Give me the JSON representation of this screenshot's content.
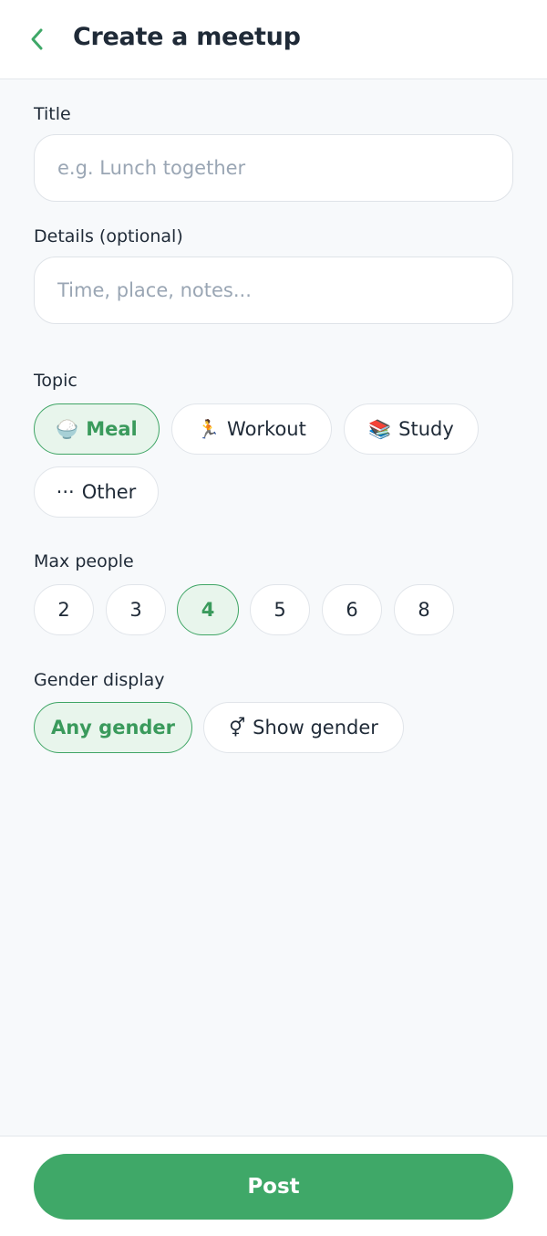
{
  "header": {
    "title": "Create a meetup",
    "back_icon": "chevron-left-icon"
  },
  "form": {
    "title_label": "Title",
    "title_placeholder": "e.g. Lunch together",
    "details_label": "Details (optional)",
    "details_placeholder": "Time, place, notes...",
    "topic_label": "Topic",
    "topics": [
      {
        "icon": "🍚",
        "label": "Meal",
        "selected": true
      },
      {
        "icon": "🏃",
        "label": "Workout",
        "selected": false
      },
      {
        "icon": "📚",
        "label": "Study",
        "selected": false
      },
      {
        "icon": "···",
        "label": "Other",
        "selected": false
      }
    ],
    "max_people_label": "Max people",
    "max_people_options": [
      "2",
      "3",
      "4",
      "5",
      "6",
      "8"
    ],
    "max_people_selected": "4",
    "gender_label": "Gender display",
    "gender_options": [
      {
        "icon": "",
        "label": "Any gender",
        "selected": true
      },
      {
        "icon": "⚥",
        "label": "Show gender",
        "selected": false
      }
    ]
  },
  "footer": {
    "post_label": "Post"
  },
  "colors": {
    "accent": "#3fa868",
    "accent_bg": "#e8f5ec",
    "text": "#1f2a37",
    "placeholder": "#9aa6b4"
  }
}
